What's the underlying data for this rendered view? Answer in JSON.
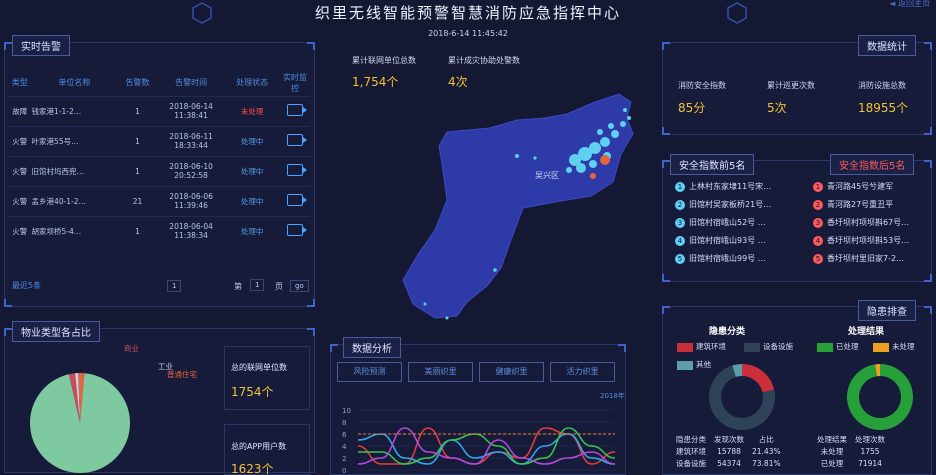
{
  "header": {
    "title": "织里无线智能预警智慧消防应急指挥中心",
    "datetime": "2018-6-14 11:45:42",
    "back_label": "◄ 返回主页"
  },
  "alarms": {
    "title": "实时告警",
    "columns": [
      "类型",
      "单位名称",
      "告警数",
      "告警时间",
      "处理状态",
      "实时监控"
    ],
    "rows": [
      {
        "type": "故障",
        "unit": "钱家港1-1-2…",
        "count": "1",
        "date": "2018-06-14",
        "time": "11:38:41",
        "status": "未处理"
      },
      {
        "type": "火警",
        "unit": "叶家港55号…",
        "count": "1",
        "date": "2018-06-11",
        "time": "18:33:44",
        "status": "处理中"
      },
      {
        "type": "火警",
        "unit": "旧馆村坞西兜…",
        "count": "1",
        "date": "2018-06-10",
        "time": "20:52:58",
        "status": "处理中"
      },
      {
        "type": "火警",
        "unit": "孟乡港40-1-2…",
        "count": "21",
        "date": "2018-06-06",
        "time": "11:39:46",
        "status": "处理中"
      },
      {
        "type": "火警",
        "unit": "胡家坝桥5-4…",
        "count": "1",
        "date": "2018-06-04",
        "time": "11:38:34",
        "status": "处理中"
      }
    ],
    "recent": "最近5条",
    "page_prefix": "第",
    "page_num": "1",
    "page_suffix": "页",
    "page_total": "1",
    "go": "go"
  },
  "center_stats": {
    "units_label": "累计联网单位总数",
    "units_value": "1,754个",
    "rescue_label": "累计成灾协助处警数",
    "rescue_value": "4次"
  },
  "map": {
    "place_label": "吴兴区"
  },
  "data_stats": {
    "title": "数据统计",
    "items": [
      {
        "label": "消防安全指数",
        "value": "85分"
      },
      {
        "label": "累计巡更次数",
        "value": "5次"
      },
      {
        "label": "消防设施总数",
        "value": "18955个"
      }
    ]
  },
  "safety": {
    "top_title": "安全指数前5名",
    "bottom_title": "安全指数后5名",
    "top": [
      "上林村东家埭11号宋…",
      "旧馆村吴家板桥21号…",
      "旧馆村宿峨山52号 …",
      "旧馆村宿峨山93号 …",
      "旧馆村宿峨山99号 …"
    ],
    "bottom": [
      "青河路45号兮建军",
      "青河路27号重丑平",
      "香圩坝村项坝斟67号…",
      "香圩坝村项坝斟53号…",
      "香圩坝村里旧家7-2…"
    ]
  },
  "property": {
    "title": "物业类型各占比",
    "legend": [
      "商业",
      "工业",
      "普通住宅"
    ],
    "units_label": "总的联网单位数",
    "units_value": "1754个",
    "users_label": "总的APP用户数",
    "users_value": "1623个"
  },
  "analysis": {
    "title": "数据分析",
    "tabs": [
      "风险预测",
      "美丽织里",
      "健康织里",
      "活力织里"
    ],
    "year": "2018年",
    "yticks": [
      "10",
      "8",
      "6",
      "4",
      "2",
      "0"
    ]
  },
  "hazard": {
    "title": "隐患排查",
    "cat_title": "隐患分类",
    "res_title": "处理结果",
    "cat_legend": [
      "建筑环境",
      "设备设施",
      "其他"
    ],
    "res_legend": [
      "已处理",
      "未处理"
    ],
    "cat_table": {
      "head": [
        "隐患分类",
        "发现次数",
        "占比"
      ],
      "rows": [
        [
          "建筑环境",
          "15788",
          "21.43%"
        ],
        [
          "设备设施",
          "54374",
          "73.81%"
        ]
      ]
    },
    "res_table": {
      "head": [
        "处理结果",
        "处理次数"
      ],
      "rows": [
        [
          "未处理",
          "1755"
        ],
        [
          "已处理",
          "71914"
        ]
      ]
    }
  },
  "chart_data": [
    {
      "type": "pie",
      "title": "物业类型各占比",
      "labels": [
        "商业",
        "工业",
        "普通住宅",
        "其他"
      ],
      "values": [
        2,
        1,
        2,
        95
      ]
    },
    {
      "type": "pie",
      "title": "隐患分类",
      "labels": [
        "建筑环境",
        "设备设施",
        "其他"
      ],
      "values": [
        21.43,
        73.81,
        4.76
      ]
    },
    {
      "type": "pie",
      "title": "处理结果",
      "labels": [
        "已处理",
        "未处理"
      ],
      "values": [
        71914,
        1755
      ]
    },
    {
      "type": "line",
      "title": "数据分析",
      "ylim": [
        0,
        10
      ],
      "x": [
        1,
        2,
        3,
        4,
        5,
        6,
        7,
        8,
        9,
        10,
        11,
        12
      ],
      "series": [
        {
          "values": [
            4,
            1,
            1,
            7,
            2,
            1,
            3,
            2,
            7,
            6,
            1,
            3
          ]
        },
        {
          "values": [
            5,
            6,
            2,
            1,
            5,
            2,
            3,
            1,
            4,
            6,
            2,
            1
          ]
        },
        {
          "values": [
            3,
            3,
            1,
            2,
            5,
            6,
            4,
            1,
            2,
            7,
            4,
            2
          ]
        },
        {
          "values": [
            1,
            2,
            7,
            3,
            2,
            1,
            5,
            2,
            1,
            2,
            3,
            1
          ]
        },
        {
          "values": [
            6,
            6,
            6,
            6,
            6,
            6,
            6,
            6,
            6,
            6,
            6,
            6
          ]
        }
      ]
    }
  ]
}
